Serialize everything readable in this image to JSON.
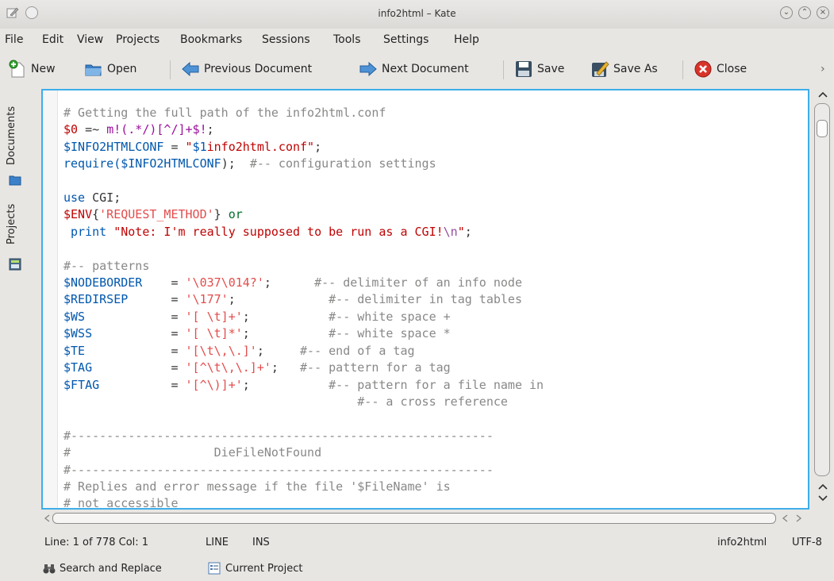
{
  "window": {
    "title": "info2html – Kate"
  },
  "menu": [
    "File",
    "Edit",
    "View",
    "Projects",
    "Bookmarks",
    "Sessions",
    "Tools",
    "Settings",
    "Help"
  ],
  "toolbar": {
    "new": "New",
    "open": "Open",
    "prev": "Previous Document",
    "next": "Next Document",
    "save": "Save",
    "save_as": "Save As",
    "close": "Close",
    "more": "›"
  },
  "sidebar": {
    "documents": "Documents",
    "projects": "Projects"
  },
  "code": {
    "l1": "# Getting the full path of the info2html.conf",
    "l2a": "$0",
    "l2b": " =~ ",
    "l2c": "m!(.*/)[^/]+$!",
    "l2d": ";",
    "l3a": "$INFO2HTMLCONF",
    "l3b": " = ",
    "l3c": "\"",
    "l3d": "$1",
    "l3e": "info2html.conf\"",
    "l3f": ";",
    "l4a": "require(",
    "l4b": "$INFO2HTMLCONF",
    "l4c": ");  ",
    "l4d": "#-- configuration settings",
    "l6a": "use",
    "l6b": " CGI;",
    "l7a": "$ENV",
    "l7b": "{",
    "l7c": "'REQUEST_METHOD'",
    "l7d": "} ",
    "l7e": "or",
    "l8a": " print ",
    "l8b": "\"Note: I'm really supposed to be run as a CGI!",
    "l8c": "\\n",
    "l8d": "\"",
    "l8e": ";",
    "l10": "#-- patterns",
    "vars": [
      {
        "name": "$NODEBORDER",
        "pad": "    = ",
        "val": "'\\037\\014?'",
        "sp": ";      ",
        "cmt": "#-- delimiter of an info node"
      },
      {
        "name": "$REDIRSEP",
        "pad": "      = ",
        "val": "'\\177'",
        "sp": ";             ",
        "cmt": "#-- delimiter in tag tables"
      },
      {
        "name": "$WS",
        "pad": "            = ",
        "val": "'[ \\t]+'",
        "sp": ";           ",
        "cmt": "#-- white space +"
      },
      {
        "name": "$WSS",
        "pad": "           = ",
        "val": "'[ \\t]*'",
        "sp": ";           ",
        "cmt": "#-- white space *"
      },
      {
        "name": "$TE",
        "pad": "            = ",
        "val": "'[\\t\\,\\.]'",
        "sp": ";     ",
        "cmt": "#-- end of a tag"
      },
      {
        "name": "$TAG",
        "pad": "           = ",
        "val": "'[^\\t\\,\\.]+'",
        "sp": ";   ",
        "cmt": "#-- pattern for a tag"
      },
      {
        "name": "$FTAG",
        "pad": "          = ",
        "val": "'[^\\)]+'",
        "sp": ";           ",
        "cmt": "#-- pattern for a file name in"
      }
    ],
    "l18": "                                         #-- a cross reference",
    "l20": "#-----------------------------------------------------------",
    "l21": "#                    DieFileNotFound",
    "l22": "#-----------------------------------------------------------",
    "l23": "# Replies and error message if the file '$FileName' is",
    "l24": "# not accessible"
  },
  "status": {
    "position": "Line: 1 of 778 Col: 1",
    "mode_line": "LINE",
    "mode_ins": "INS",
    "syntax": "info2html",
    "encoding": "UTF-8"
  },
  "bottom": {
    "search": "Search and Replace",
    "project": "Current Project"
  }
}
